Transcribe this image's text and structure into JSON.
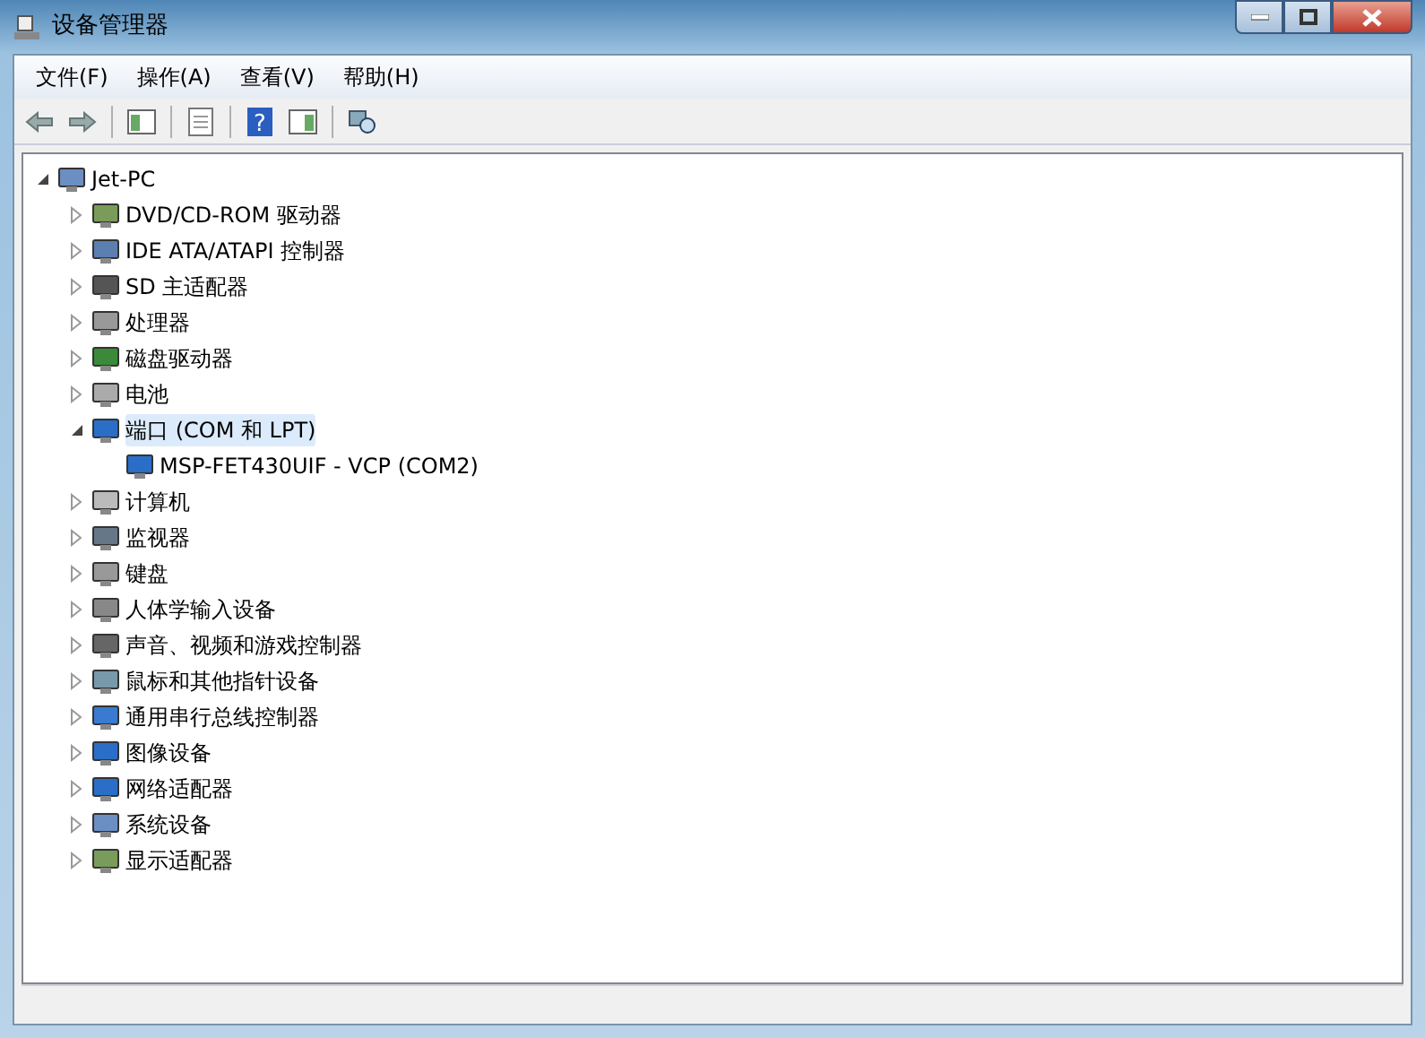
{
  "window": {
    "title": "设备管理器"
  },
  "menu": [
    {
      "label": "文件(F)"
    },
    {
      "label": "操作(A)"
    },
    {
      "label": "查看(V)"
    },
    {
      "label": "帮助(H)"
    }
  ],
  "toolbar": {
    "help_mark": "?"
  },
  "tree": [
    {
      "label": "Jet-PC",
      "expanded": true,
      "selected": false,
      "children": [
        {
          "label": "DVD/CD-ROM 驱动器",
          "expanded": false,
          "selected": false
        },
        {
          "label": "IDE ATA/ATAPI 控制器",
          "expanded": false,
          "selected": false
        },
        {
          "label": "SD 主适配器",
          "expanded": false,
          "selected": false
        },
        {
          "label": "处理器",
          "expanded": false,
          "selected": false
        },
        {
          "label": "磁盘驱动器",
          "expanded": false,
          "selected": false
        },
        {
          "label": "电池",
          "expanded": false,
          "selected": false
        },
        {
          "label": "端口 (COM 和 LPT)",
          "expanded": true,
          "selected": true,
          "children": [
            {
              "label": "MSP-FET430UIF - VCP (COM2)",
              "selected": false
            }
          ]
        },
        {
          "label": "计算机",
          "expanded": false,
          "selected": false
        },
        {
          "label": "监视器",
          "expanded": false,
          "selected": false
        },
        {
          "label": "键盘",
          "expanded": false,
          "selected": false
        },
        {
          "label": "人体学输入设备",
          "expanded": false,
          "selected": false
        },
        {
          "label": "声音、视频和游戏控制器",
          "expanded": false,
          "selected": false
        },
        {
          "label": "鼠标和其他指针设备",
          "expanded": false,
          "selected": false
        },
        {
          "label": "通用串行总线控制器",
          "expanded": false,
          "selected": false
        },
        {
          "label": "图像设备",
          "expanded": false,
          "selected": false
        },
        {
          "label": "网络适配器",
          "expanded": false,
          "selected": false
        },
        {
          "label": "系统设备",
          "expanded": false,
          "selected": false
        },
        {
          "label": "显示适配器",
          "expanded": false,
          "selected": false
        }
      ]
    }
  ]
}
